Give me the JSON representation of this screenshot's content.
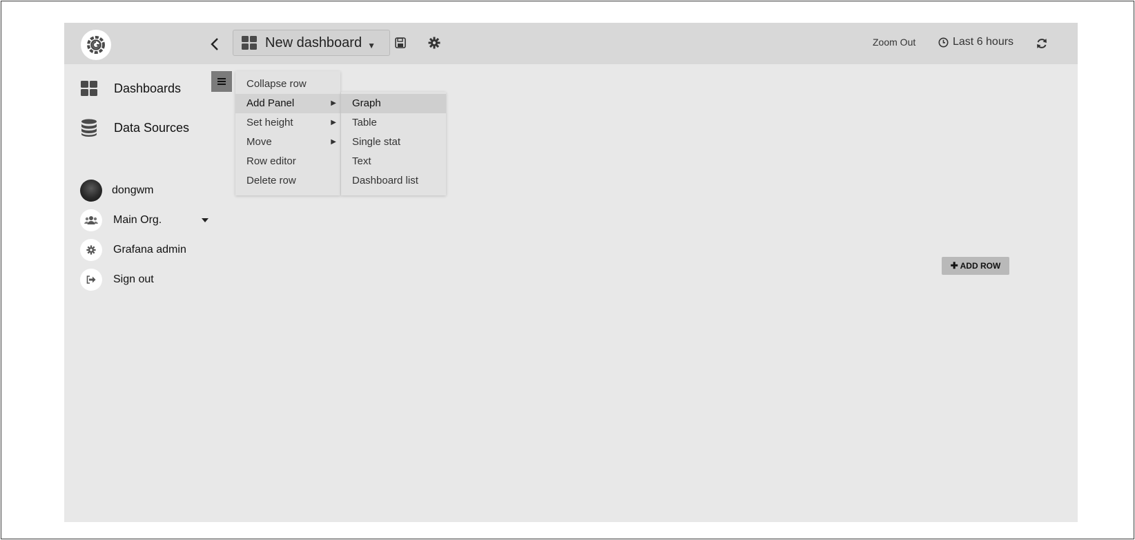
{
  "topbar": {
    "dashboard_title": "New dashboard",
    "zoom_out_label": "Zoom Out",
    "time_range_label": "Last 6 hours"
  },
  "sidebar": {
    "nav": [
      {
        "label": "Dashboards",
        "icon": "dashboards-grid-icon"
      },
      {
        "label": "Data Sources",
        "icon": "database-icon"
      }
    ],
    "user": [
      {
        "label": "dongwm",
        "icon": "avatar"
      },
      {
        "label": "Main Org.",
        "icon": "users-icon"
      },
      {
        "label": "Grafana admin",
        "icon": "gear-icon"
      },
      {
        "label": "Sign out",
        "icon": "sign-out-icon"
      }
    ]
  },
  "row_menu": {
    "items": [
      {
        "label": "Collapse row"
      },
      {
        "label": "Add Panel"
      },
      {
        "label": "Set height"
      },
      {
        "label": "Move"
      },
      {
        "label": "Row editor"
      },
      {
        "label": "Delete row"
      }
    ],
    "add_panel_submenu": [
      {
        "label": "Graph"
      },
      {
        "label": "Table"
      },
      {
        "label": "Single stat"
      },
      {
        "label": "Text"
      },
      {
        "label": "Dashboard list"
      }
    ]
  },
  "add_row_label": "ADD ROW",
  "colors": {
    "topbar_bg": "#d8d8d8",
    "canvas_bg": "#e8e8e8",
    "menu_bg": "#e2e2e2",
    "menu_active_bg": "#d3d3d3",
    "add_row_bg": "#b9b9b9"
  }
}
